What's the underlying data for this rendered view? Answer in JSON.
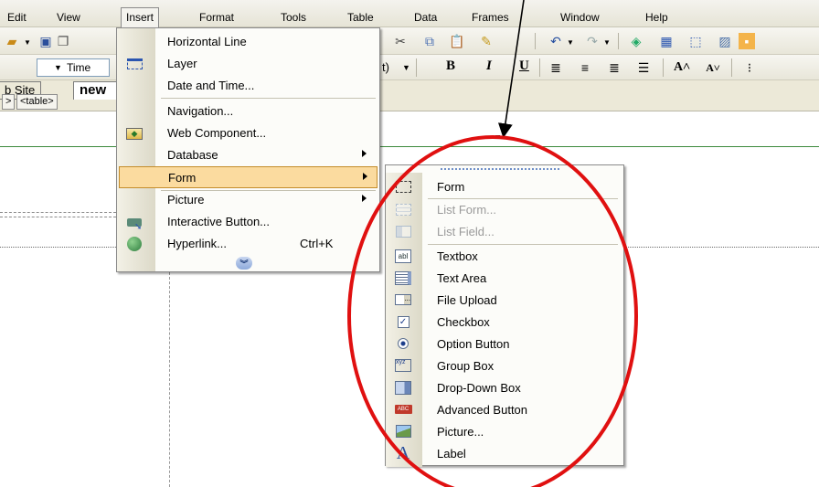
{
  "menubar": {
    "items": [
      "Edit",
      "View",
      "Insert",
      "Format",
      "Tools",
      "Table",
      "Data",
      "Frames",
      "Window",
      "Help"
    ]
  },
  "toolbar": {
    "font_name": "Time",
    "font_size_tail": "t)",
    "bold": "B",
    "italic": "I",
    "underline": "U"
  },
  "tabs": {
    "web_site": "b Site",
    "new_page": "new"
  },
  "tag_selector": {
    "items": [
      ">",
      "<table>"
    ]
  },
  "insert_menu": {
    "items": [
      {
        "label": "Horizontal Line",
        "icon": "none"
      },
      {
        "label": "Layer",
        "icon": "layer-icon"
      },
      {
        "label": "Date and Time...",
        "icon": "none"
      },
      {
        "label": "Navigation...",
        "icon": "none"
      },
      {
        "label": "Web Component...",
        "icon": "web-component-icon"
      },
      {
        "label": "Database",
        "icon": "none",
        "submenu": true
      },
      {
        "label": "Form",
        "icon": "none",
        "submenu": true,
        "highlighted": true
      },
      {
        "label": "Picture",
        "icon": "none",
        "submenu": true
      },
      {
        "label": "Interactive Button...",
        "icon": "interactive-button-icon"
      },
      {
        "label": "Hyperlink...",
        "icon": "hyperlink-icon",
        "shortcut": "Ctrl+K"
      }
    ],
    "more_icon": "double-chevron-down-icon"
  },
  "form_menu": {
    "items": [
      {
        "label": "Form",
        "icon": "form-icon",
        "enabled": true
      },
      {
        "label": "List Form...",
        "icon": "list-form-icon",
        "enabled": false
      },
      {
        "label": "List Field...",
        "icon": "list-field-icon",
        "enabled": false
      },
      {
        "label": "Textbox",
        "icon": "textbox-icon",
        "enabled": true
      },
      {
        "label": "Text Area",
        "icon": "text-area-icon",
        "enabled": true
      },
      {
        "label": "File Upload",
        "icon": "file-upload-icon",
        "enabled": true
      },
      {
        "label": "Checkbox",
        "icon": "checkbox-icon",
        "enabled": true
      },
      {
        "label": "Option Button",
        "icon": "option-button-icon",
        "enabled": true
      },
      {
        "label": "Group Box",
        "icon": "group-box-icon",
        "enabled": true
      },
      {
        "label": "Drop-Down Box",
        "icon": "drop-down-box-icon",
        "enabled": true
      },
      {
        "label": "Advanced Button",
        "icon": "advanced-button-icon",
        "enabled": true
      },
      {
        "label": "Picture...",
        "icon": "picture-icon",
        "enabled": true
      },
      {
        "label": "Label",
        "icon": "label-icon",
        "enabled": true
      }
    ]
  },
  "icon_glyphs": {
    "textbox": "abl",
    "advanced_button": "ABC",
    "group_box": "xyz",
    "label": "A"
  },
  "colors": {
    "menu_highlight": "#fbdb9f",
    "annotation_ellipse": "#e01010",
    "annotation_arrow": "#000000"
  }
}
